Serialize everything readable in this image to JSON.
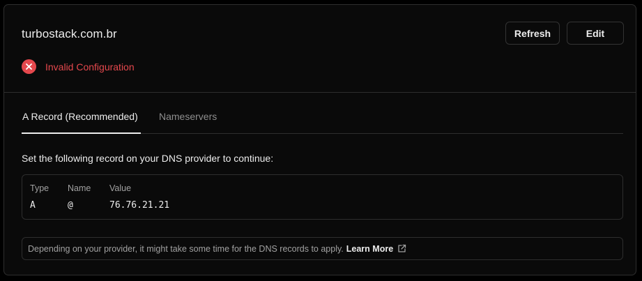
{
  "domain": {
    "name": "turbostack.com.br",
    "status_text": "Invalid Configuration",
    "status_icon": "x-circle-icon",
    "status_color": "#e5484d"
  },
  "actions": {
    "refresh_label": "Refresh",
    "edit_label": "Edit"
  },
  "tabs": [
    {
      "label": "A Record (Recommended)",
      "active": true
    },
    {
      "label": "Nameservers",
      "active": false
    }
  ],
  "instruction": "Set the following record on your DNS provider to continue:",
  "record": {
    "headers": [
      "Type",
      "Name",
      "Value"
    ],
    "values": [
      "A",
      "@",
      "76.76.21.21"
    ]
  },
  "note": {
    "text": "Depending on your provider, it might take some time for the DNS records to apply.",
    "link_label": "Learn More",
    "link_icon": "external-link-icon"
  }
}
